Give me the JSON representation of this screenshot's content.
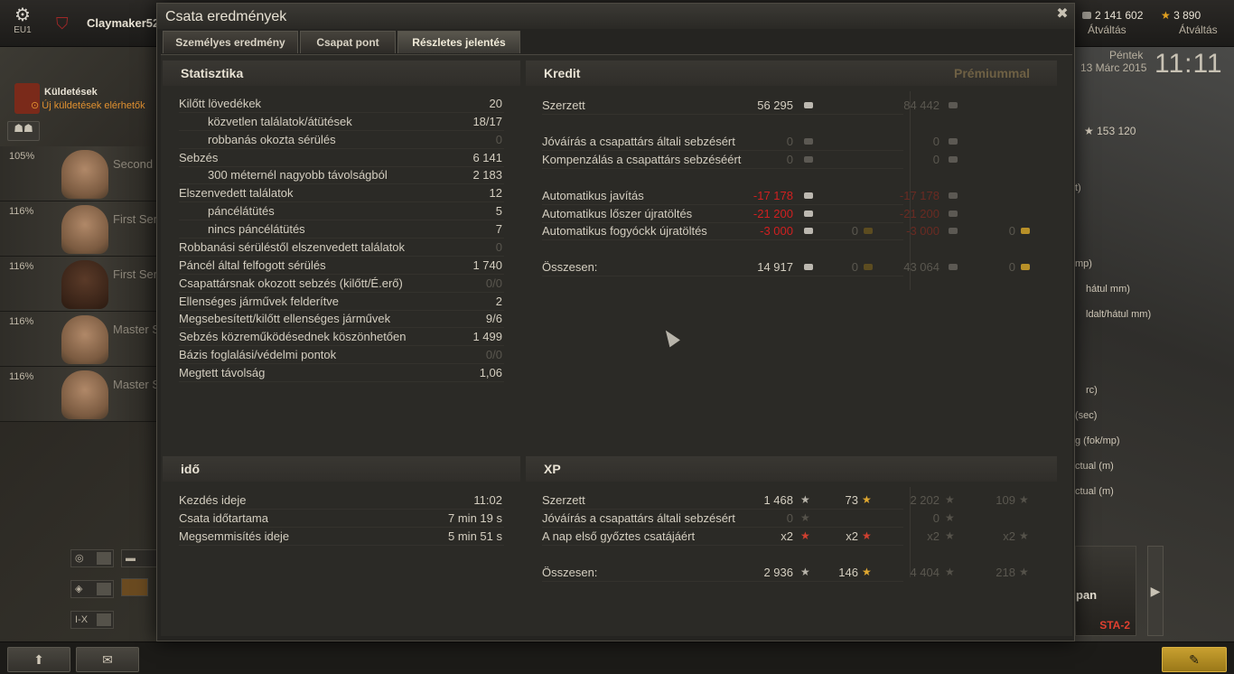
{
  "topbar": {
    "server_label": "EU1",
    "player_name": "Claymaker52",
    "credits": "2 141 602",
    "credits_action": "Átváltás",
    "gold": "3 890",
    "gold_action": "Átváltás",
    "day": "Péntek",
    "date": "13 Márc 2015",
    "time": "11:11"
  },
  "missions": {
    "title": "Küldetések",
    "subtitle": "Új küldetések elérhetők"
  },
  "crew": [
    {
      "pct": "105%",
      "role": "Second L"
    },
    {
      "pct": "116%",
      "role": "First Ser"
    },
    {
      "pct": "116%",
      "role": "First Ser"
    },
    {
      "pct": "116%",
      "role": "Master S"
    },
    {
      "pct": "116%",
      "role": "Master S"
    }
  ],
  "filters": {
    "tier": "I-X"
  },
  "right_panel": {
    "stat": "153 120",
    "labels": [
      "t)",
      "mp)",
      "hátul mm)",
      "ldalt/hátul mm)",
      "rc)",
      "(sec)",
      "g (fok/mp)",
      "ctual (m)",
      "ctual (m)"
    ],
    "vehicle_name": "STA-2",
    "vehicle_label": "pan"
  },
  "dialog": {
    "title": "Csata eredmények",
    "tabs": [
      "Személyes eredmény",
      "Csapat pont",
      "Részletes jelentés"
    ],
    "active_tab": 2,
    "stats": {
      "heading": "Statisztika",
      "rows": [
        {
          "label": "Kilőtt lövedékek",
          "value": "20",
          "indent": false,
          "faint": false
        },
        {
          "label": "közvetlen találatok/átütések",
          "value": "18/17",
          "indent": true,
          "faint": false
        },
        {
          "label": "robbanás okozta sérülés",
          "value": "0",
          "indent": true,
          "faint": true
        },
        {
          "label": "Sebzés",
          "value": "6 141",
          "indent": false,
          "faint": false
        },
        {
          "label": "300 méternél nagyobb távolságból",
          "value": "2 183",
          "indent": true,
          "faint": false
        },
        {
          "label": "Elszenvedett találatok",
          "value": "12",
          "indent": false,
          "faint": false
        },
        {
          "label": "páncélátütés",
          "value": "5",
          "indent": true,
          "faint": false
        },
        {
          "label": "nincs páncélátütés",
          "value": "7",
          "indent": true,
          "faint": false
        },
        {
          "label": "Robbanási sérüléstől elszenvedett találatok",
          "value": "0",
          "indent": false,
          "faint": true
        },
        {
          "label": "Páncél által felfogott sérülés",
          "value": "1 740",
          "indent": false,
          "faint": false
        },
        {
          "label": "Csapattársnak okozott sebzés (kilőtt/É.erő)",
          "value": "0/0",
          "indent": false,
          "faint": true
        },
        {
          "label": "Ellenséges járművek felderítve",
          "value": "2",
          "indent": false,
          "faint": false
        },
        {
          "label": "Megsebesített/kilőtt ellenséges járművek",
          "value": "9/6",
          "indent": false,
          "faint": false
        },
        {
          "label": "Sebzés közreműködésednek köszönhetően",
          "value": "1 499",
          "indent": false,
          "faint": false
        },
        {
          "label": "Bázis foglalási/védelmi pontok",
          "value": "0/0",
          "indent": false,
          "faint": true
        },
        {
          "label": "Megtett távolság",
          "value": "1,06",
          "indent": false,
          "faint": false
        }
      ]
    },
    "credit": {
      "heading": "Kredit",
      "premium_label": "Prémiummal",
      "rows": [
        {
          "label": "Szerzett",
          "value": "56 295",
          "gold": "",
          "prem": "84 442",
          "prem_gold": "",
          "style": "normal"
        },
        {
          "label": "Jóváírás a csapattárs általi sebzésért",
          "value": "0",
          "gold": "",
          "prem": "0",
          "prem_gold": "",
          "style": "zero"
        },
        {
          "label": "Kompenzálás a csapattárs sebzéséért",
          "value": "0",
          "gold": "",
          "prem": "0",
          "prem_gold": "",
          "style": "zero"
        },
        {
          "label": "Automatikus javítás",
          "value": "-17 178",
          "gold": "",
          "prem": "-17 178",
          "prem_gold": "",
          "style": "red"
        },
        {
          "label": "Automatikus lőszer újratöltés",
          "value": "-21 200",
          "gold": "",
          "prem": "-21 200",
          "prem_gold": "",
          "style": "red"
        },
        {
          "label": "Automatikus fogyóckk újratöltés",
          "value": "-3 000",
          "gold": "0",
          "prem": "-3 000",
          "prem_gold": "0",
          "style": "red"
        },
        {
          "label": "Összesen:",
          "value": "14 917",
          "gold": "0",
          "prem": "43 064",
          "prem_gold": "0",
          "style": "normal"
        }
      ]
    },
    "time": {
      "heading": "idő",
      "rows": [
        {
          "label": "Kezdés ideje",
          "value": "11:02"
        },
        {
          "label": "Csata időtartama",
          "value": "7 min 19 s"
        },
        {
          "label": "Megsemmisítés ideje",
          "value": "5 min 51 s"
        }
      ]
    },
    "xp": {
      "heading": "XP",
      "rows": [
        {
          "label": "Szerzett",
          "xp": "1 468",
          "free": "73",
          "prem_xp": "2 202",
          "prem_free": "109",
          "style": "normal"
        },
        {
          "label": "Jóváírás a csapattárs általi sebzésért",
          "xp": "0",
          "free": "",
          "prem_xp": "0",
          "prem_free": "",
          "style": "zero"
        },
        {
          "label": "A nap első győztes csatájáért",
          "xp": "x2",
          "free": "x2",
          "prem_xp": "x2",
          "prem_free": "x2",
          "style": "mult"
        },
        {
          "label": "Összesen:",
          "xp": "2 936",
          "free": "146",
          "prem_xp": "4 404",
          "prem_free": "218",
          "style": "normal"
        }
      ]
    }
  }
}
